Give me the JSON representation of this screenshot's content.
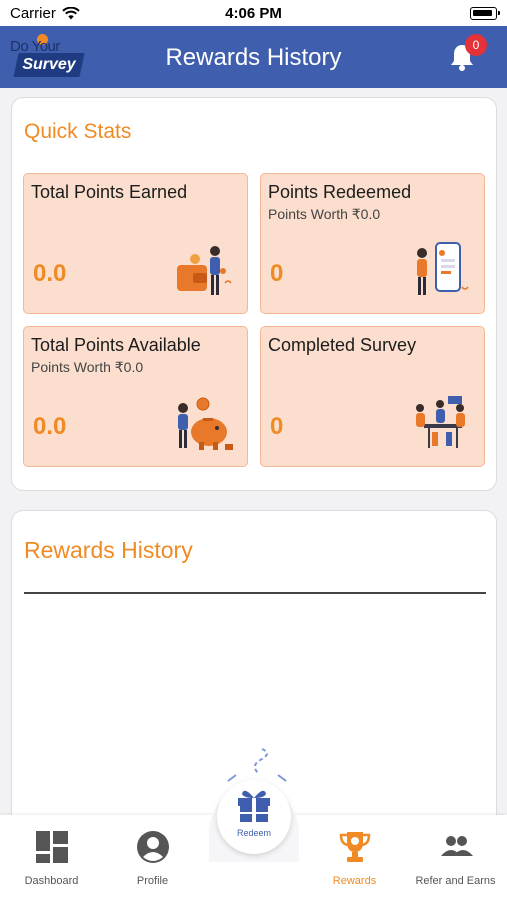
{
  "status_bar": {
    "carrier": "Carrier",
    "time": "4:06 PM"
  },
  "header": {
    "logo_top": "Do Your",
    "logo_bottom": "Survey",
    "title": "Rewards History",
    "notification_count": "0",
    "colors": {
      "background": "#3f5fae",
      "badge": "#e53238"
    }
  },
  "quick_stats": {
    "title": "Quick Stats",
    "cards": [
      {
        "label": "Total Points Earned",
        "sub": "",
        "value": "0.0",
        "icon": "wallet-person-illustration"
      },
      {
        "label": "Points Redeemed",
        "sub": "Points Worth ₹0.0",
        "value": "0",
        "icon": "phone-person-illustration"
      },
      {
        "label": "Total Points Available",
        "sub": "Points Worth ₹0.0",
        "value": "0.0",
        "icon": "piggy-bank-illustration"
      },
      {
        "label": "Completed Survey",
        "sub": "",
        "value": "0",
        "icon": "team-meeting-illustration"
      }
    ]
  },
  "rewards_history": {
    "title": "Rewards History"
  },
  "redeem": {
    "label": "Redeem"
  },
  "tab_bar": {
    "tabs": [
      {
        "label": "Dashboard",
        "icon": "dashboard-icon",
        "active": false
      },
      {
        "label": "Profile",
        "icon": "profile-icon",
        "active": false
      },
      {
        "label": "Rewards",
        "icon": "trophy-icon",
        "active": true
      },
      {
        "label": "Refer and Earns",
        "icon": "people-icon",
        "active": false
      }
    ]
  },
  "colors": {
    "accent": "#f08a24",
    "card_bg": "#fbdecd",
    "primary": "#3f5fae"
  }
}
